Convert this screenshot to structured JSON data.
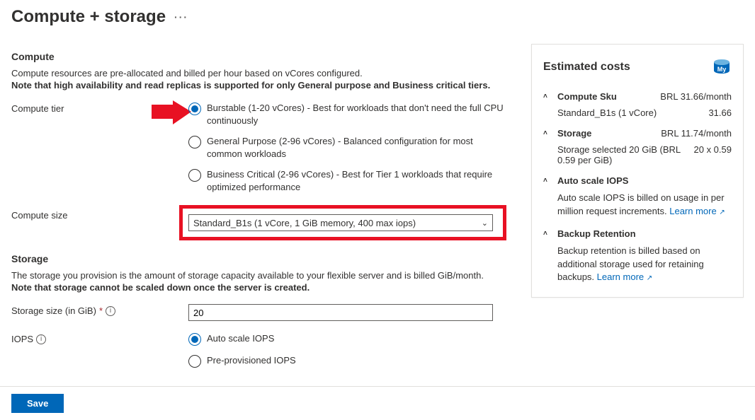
{
  "page": {
    "title": "Compute + storage",
    "more_label": "···"
  },
  "compute": {
    "heading": "Compute",
    "desc1": "Compute resources are pre-allocated and billed per hour based on vCores configured.",
    "desc2": "Note that high availability and read replicas is supported for only General purpose and Business critical tiers.",
    "tier_label": "Compute tier",
    "tiers": [
      {
        "label": "Burstable (1-20 vCores) - Best for workloads that don't need the full CPU continuously",
        "checked": true
      },
      {
        "label": "General Purpose (2-96 vCores) - Balanced configuration for most common workloads",
        "checked": false
      },
      {
        "label": "Business Critical (2-96 vCores) - Best for Tier 1 workloads that require optimized performance",
        "checked": false
      }
    ],
    "size_label": "Compute size",
    "size_value": "Standard_B1s (1 vCore, 1 GiB memory, 400 max iops)"
  },
  "storage": {
    "heading": "Storage",
    "desc1": "The storage you provision is the amount of storage capacity available to your flexible server and is billed GiB/month.",
    "desc2": "Note that storage cannot be scaled down once the server is created.",
    "size_label": "Storage size (in GiB)",
    "size_value": "20",
    "iops_label": "IOPS",
    "iops_options": [
      {
        "label": "Auto scale IOPS",
        "checked": true
      },
      {
        "label": "Pre-provisioned IOPS",
        "checked": false
      }
    ]
  },
  "costs": {
    "title": "Estimated costs",
    "sections": {
      "sku": {
        "title": "Compute Sku",
        "right": "BRL 31.66/month",
        "line_label": "Standard_B1s (1 vCore)",
        "line_value": "31.66"
      },
      "storage": {
        "title": "Storage",
        "right": "BRL 11.74/month",
        "line_label": "Storage selected 20 GiB (BRL 0.59 per GiB)",
        "line_value": "20 x 0.59"
      },
      "iops": {
        "title": "Auto scale IOPS",
        "body_pre": "Auto scale IOPS is billed on usage in per million request increments. ",
        "link": "Learn more"
      },
      "backup": {
        "title": "Backup Retention",
        "body_pre": "Backup retention is billed based on additional storage used for retaining backups. ",
        "link": "Learn more"
      }
    }
  },
  "footer": {
    "save_label": "Save"
  }
}
